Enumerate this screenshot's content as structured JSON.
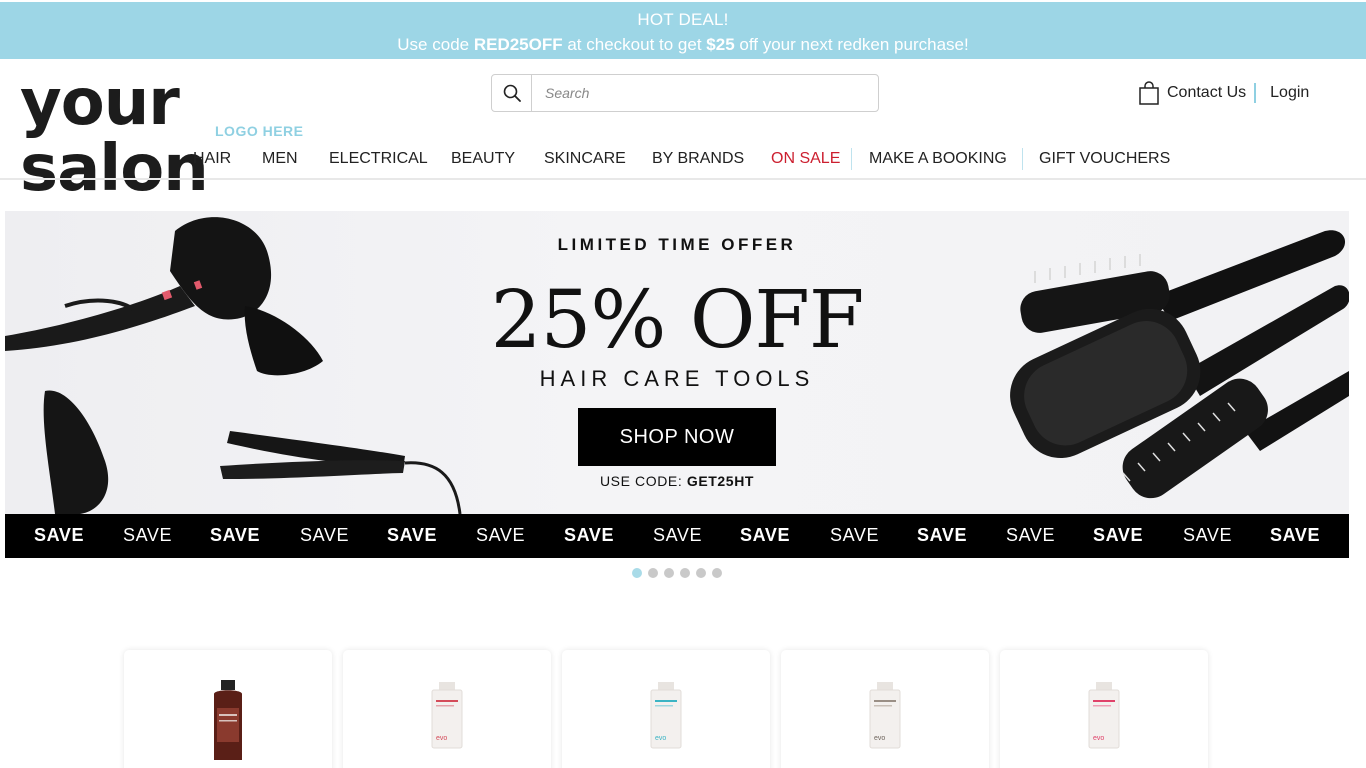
{
  "promo": {
    "line1": "HOT DEAL!",
    "line2_pre": "Use code ",
    "line2_code": "RED25OFF",
    "line2_mid": " at checkout to get ",
    "line2_amount": "$25",
    "line2_post": " off your next redken purchase!"
  },
  "logo": {
    "word": "your salon",
    "sub": "LOGO HERE"
  },
  "search": {
    "placeholder": "Search",
    "icon": "search-icon"
  },
  "utility": {
    "contact": "Contact Us",
    "login": "Login",
    "icon": "shopping-bag-icon"
  },
  "nav": {
    "items": [
      "HAIR",
      "MEN",
      "ELECTRICAL",
      "BEAUTY",
      "SKINCARE",
      "BY BRANDS",
      "ON SALE",
      "MAKE A BOOKING",
      "GIFT VOUCHERS"
    ],
    "sale_color": "#cc1f2f"
  },
  "banner": {
    "kicker": "LIMITED TIME OFFER",
    "headline": "25% OFF",
    "subline": "HAIR CARE TOOLS",
    "cta": "SHOP NOW",
    "code_label": "USE CODE: ",
    "code": "GET25HT"
  },
  "savebar": {
    "words": [
      "SAVE",
      "SAVE",
      "SAVE",
      "SAVE",
      "SAVE",
      "SAVE",
      "SAVE",
      "SAVE",
      "SAVE",
      "SAVE",
      "SAVE",
      "SAVE",
      "SAVE",
      "SAVE",
      "SAVE"
    ]
  },
  "slider": {
    "count": 6,
    "active": 1
  },
  "colors": {
    "promo_bg": "#9dd6e6",
    "accent": "#8fd0e2",
    "sale": "#cc1f2f"
  },
  "products": {
    "count": 5,
    "labels": [
      "",
      "evo",
      "evo",
      "evo",
      "evo"
    ]
  }
}
